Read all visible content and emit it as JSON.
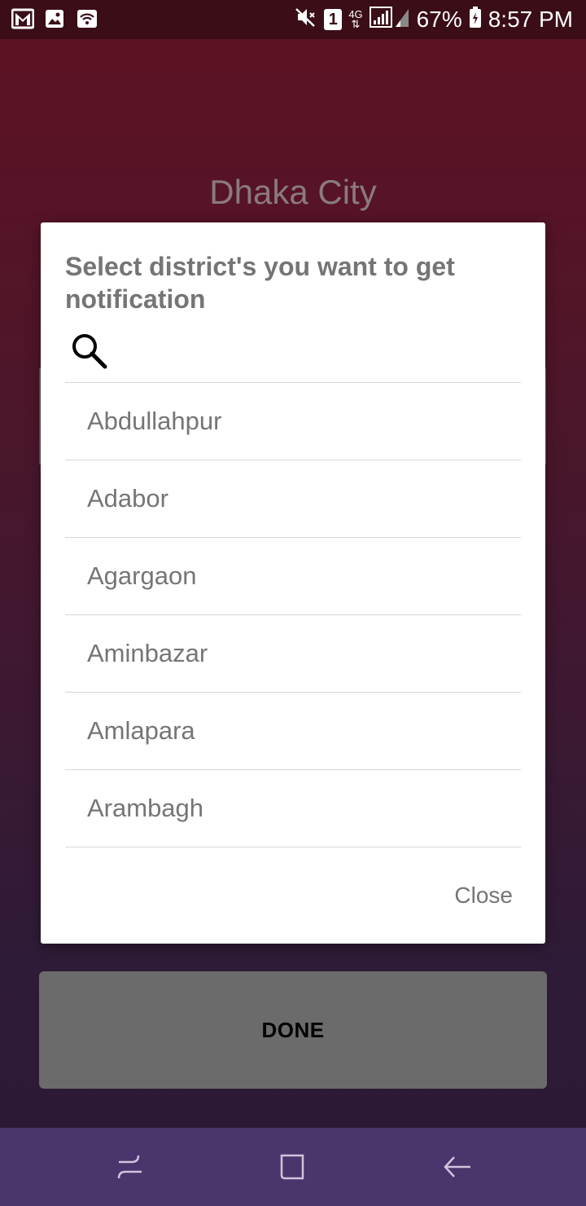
{
  "status_bar": {
    "battery": "67%",
    "time": "8:57 PM",
    "sim_slot": "1",
    "network": "4G",
    "icons": [
      "gmail-icon",
      "image-icon",
      "wifi-icon",
      "mute-icon",
      "sim-icon",
      "data-arrows-icon",
      "signal-icon",
      "battery-icon"
    ]
  },
  "background": {
    "title": "Dhaka City",
    "done_label": "DONE"
  },
  "dialog": {
    "title": "Select district's you want to get notification",
    "search": {
      "value": "",
      "placeholder": ""
    },
    "districts": [
      "Abdullahpur",
      "Adabor",
      "Agargaon",
      "Aminbazar",
      "Amlapara",
      "Arambagh"
    ],
    "close_label": "Close"
  },
  "nav_bar": {
    "icons": [
      "recents-icon",
      "home-icon",
      "back-icon"
    ]
  },
  "colors": {
    "accent_bg_top": "#5e1122",
    "accent_bg_bottom": "#2a1836",
    "nav_bar": "#4a356c",
    "dialog_text": "#757575"
  }
}
